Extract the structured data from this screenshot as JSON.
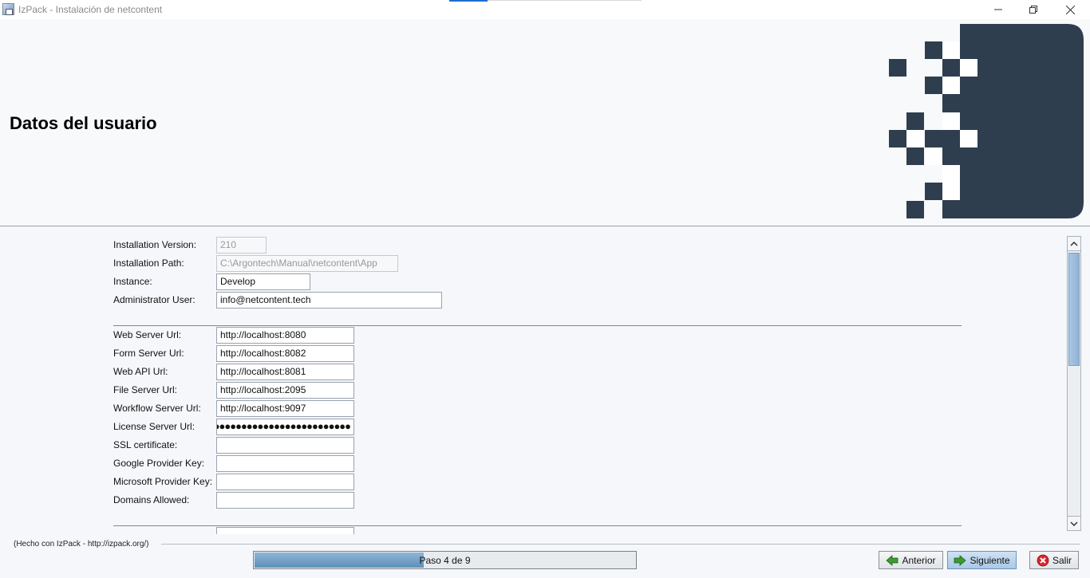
{
  "window": {
    "title": "IzPack - Instalación de  netcontent"
  },
  "header": {
    "title": "Datos del usuario"
  },
  "form": {
    "group1": [
      {
        "label": "Installation Version:",
        "value": "210",
        "disabled": true
      },
      {
        "label": "Installation Path:",
        "value": "C:\\Argontech\\Manual\\netcontent\\App",
        "disabled": true
      },
      {
        "label": "Instance:",
        "value": "Develop",
        "disabled": false
      },
      {
        "label": "Administrator User:",
        "value": "info@netcontent.tech",
        "disabled": false
      }
    ],
    "group2": [
      {
        "label": "Web Server Url:",
        "value": "http://localhost:8080"
      },
      {
        "label": "Form Server Url:",
        "value": "http://localhost:8082"
      },
      {
        "label": "Web API Url:",
        "value": "http://localhost:8081"
      },
      {
        "label": "File Server Url:",
        "value": "http://localhost:2095"
      },
      {
        "label": "Workflow Server Url:",
        "value": "http://localhost:9097"
      },
      {
        "label": "License Server Url:",
        "value": "●●●●●●●●●●●●●●●●●●●●●●●●●●"
      },
      {
        "label": "SSL certificate:",
        "value": ""
      },
      {
        "label": "Google Provider Key:",
        "value": ""
      },
      {
        "label": "Microsoft Provider Key:",
        "value": ""
      },
      {
        "label": "Domains Allowed:",
        "value": ""
      }
    ]
  },
  "footer": {
    "credit": "(Hecho con IzPack - http://izpack.org/)",
    "progress_text": "Paso 4 de 9",
    "progress": {
      "step": 4,
      "total": 9
    },
    "prev_label": "Anterior",
    "next_label": "Siguiente",
    "exit_label": "Salir"
  },
  "colors": {
    "logo": "#2e3e4e",
    "progress_fill": "#6f9ac2",
    "primary_button": "#a9c8e6",
    "exit_icon": "#d9262b",
    "arrow_icon": "#3c9a2e"
  },
  "icons": {
    "prev": "arrow-left-icon",
    "next": "arrow-right-icon",
    "exit": "cancel-icon"
  }
}
